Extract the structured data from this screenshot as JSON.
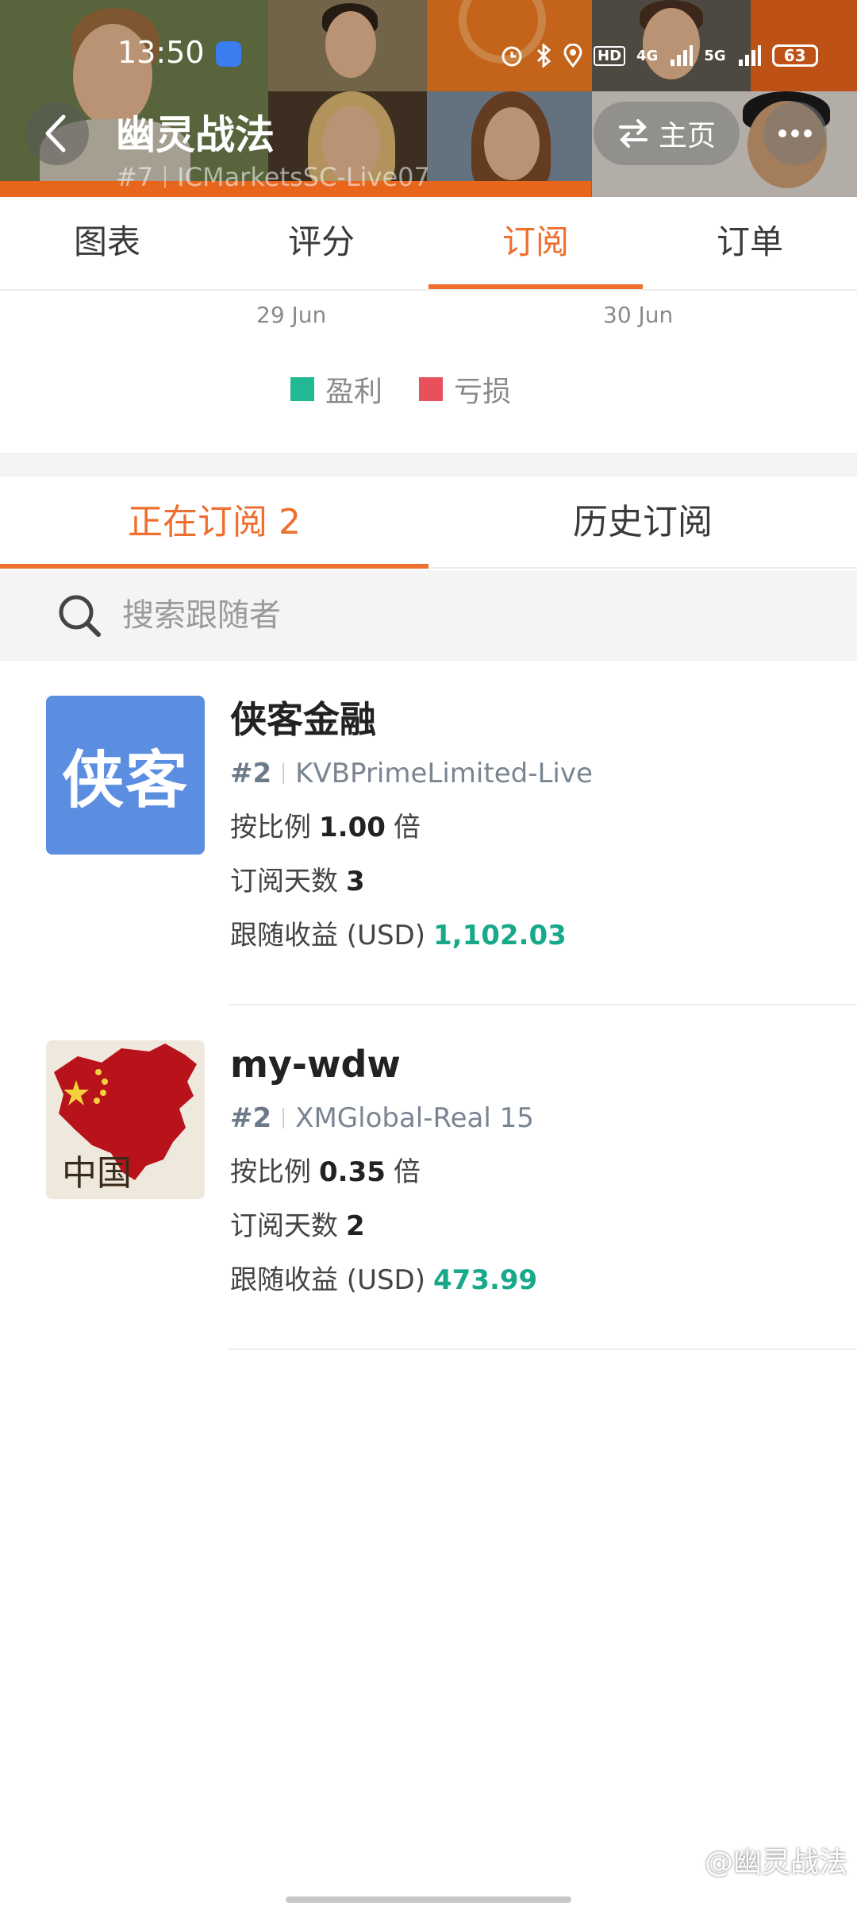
{
  "status_bar": {
    "time": "13:50",
    "hd_badge": "HD",
    "net_4g": "4G",
    "net_5g": "5G",
    "battery": "63"
  },
  "header": {
    "title": "幽灵战法",
    "rank": "#7",
    "server": "ICMarketsSC-Live07",
    "home_label": "主页"
  },
  "main_tabs": [
    {
      "label": "图表",
      "active": false
    },
    {
      "label": "评分",
      "active": false
    },
    {
      "label": "订阅",
      "active": true
    },
    {
      "label": "订单",
      "active": false
    }
  ],
  "chart": {
    "dates": [
      "29 Jun",
      "30 Jun"
    ],
    "legend": [
      {
        "label": "盈利",
        "color": "#21b894"
      },
      {
        "label": "亏损",
        "color": "#e8505b"
      }
    ]
  },
  "sub_tabs": [
    {
      "label": "正在订阅 2",
      "active": true
    },
    {
      "label": "历史订阅",
      "active": false
    }
  ],
  "search": {
    "placeholder": "搜索跟随者"
  },
  "followers": [
    {
      "name": "侠客金融",
      "avatar_text": "侠客",
      "rank": "#2",
      "server": "KVBPrimeLimited-Live",
      "ratio_label": "按比例",
      "ratio_value": "1.00",
      "ratio_unit": "倍",
      "days_label": "订阅天数",
      "days_value": "3",
      "profit_label": "跟随收益 (USD)",
      "profit_value": "1,102.03"
    },
    {
      "name": "my-wdw",
      "avatar_text": "中国",
      "rank": "#2",
      "server": "XMGlobal-Real 15",
      "ratio_label": "按比例",
      "ratio_value": "0.35",
      "ratio_unit": "倍",
      "days_label": "订阅天数",
      "days_value": "2",
      "profit_label": "跟随收益 (USD)",
      "profit_value": "473.99"
    }
  ],
  "watermark": "@幽灵战法",
  "colors": {
    "accent": "#ef6f2e",
    "profit": "#18a88a",
    "header_orange": "#e8651c"
  }
}
